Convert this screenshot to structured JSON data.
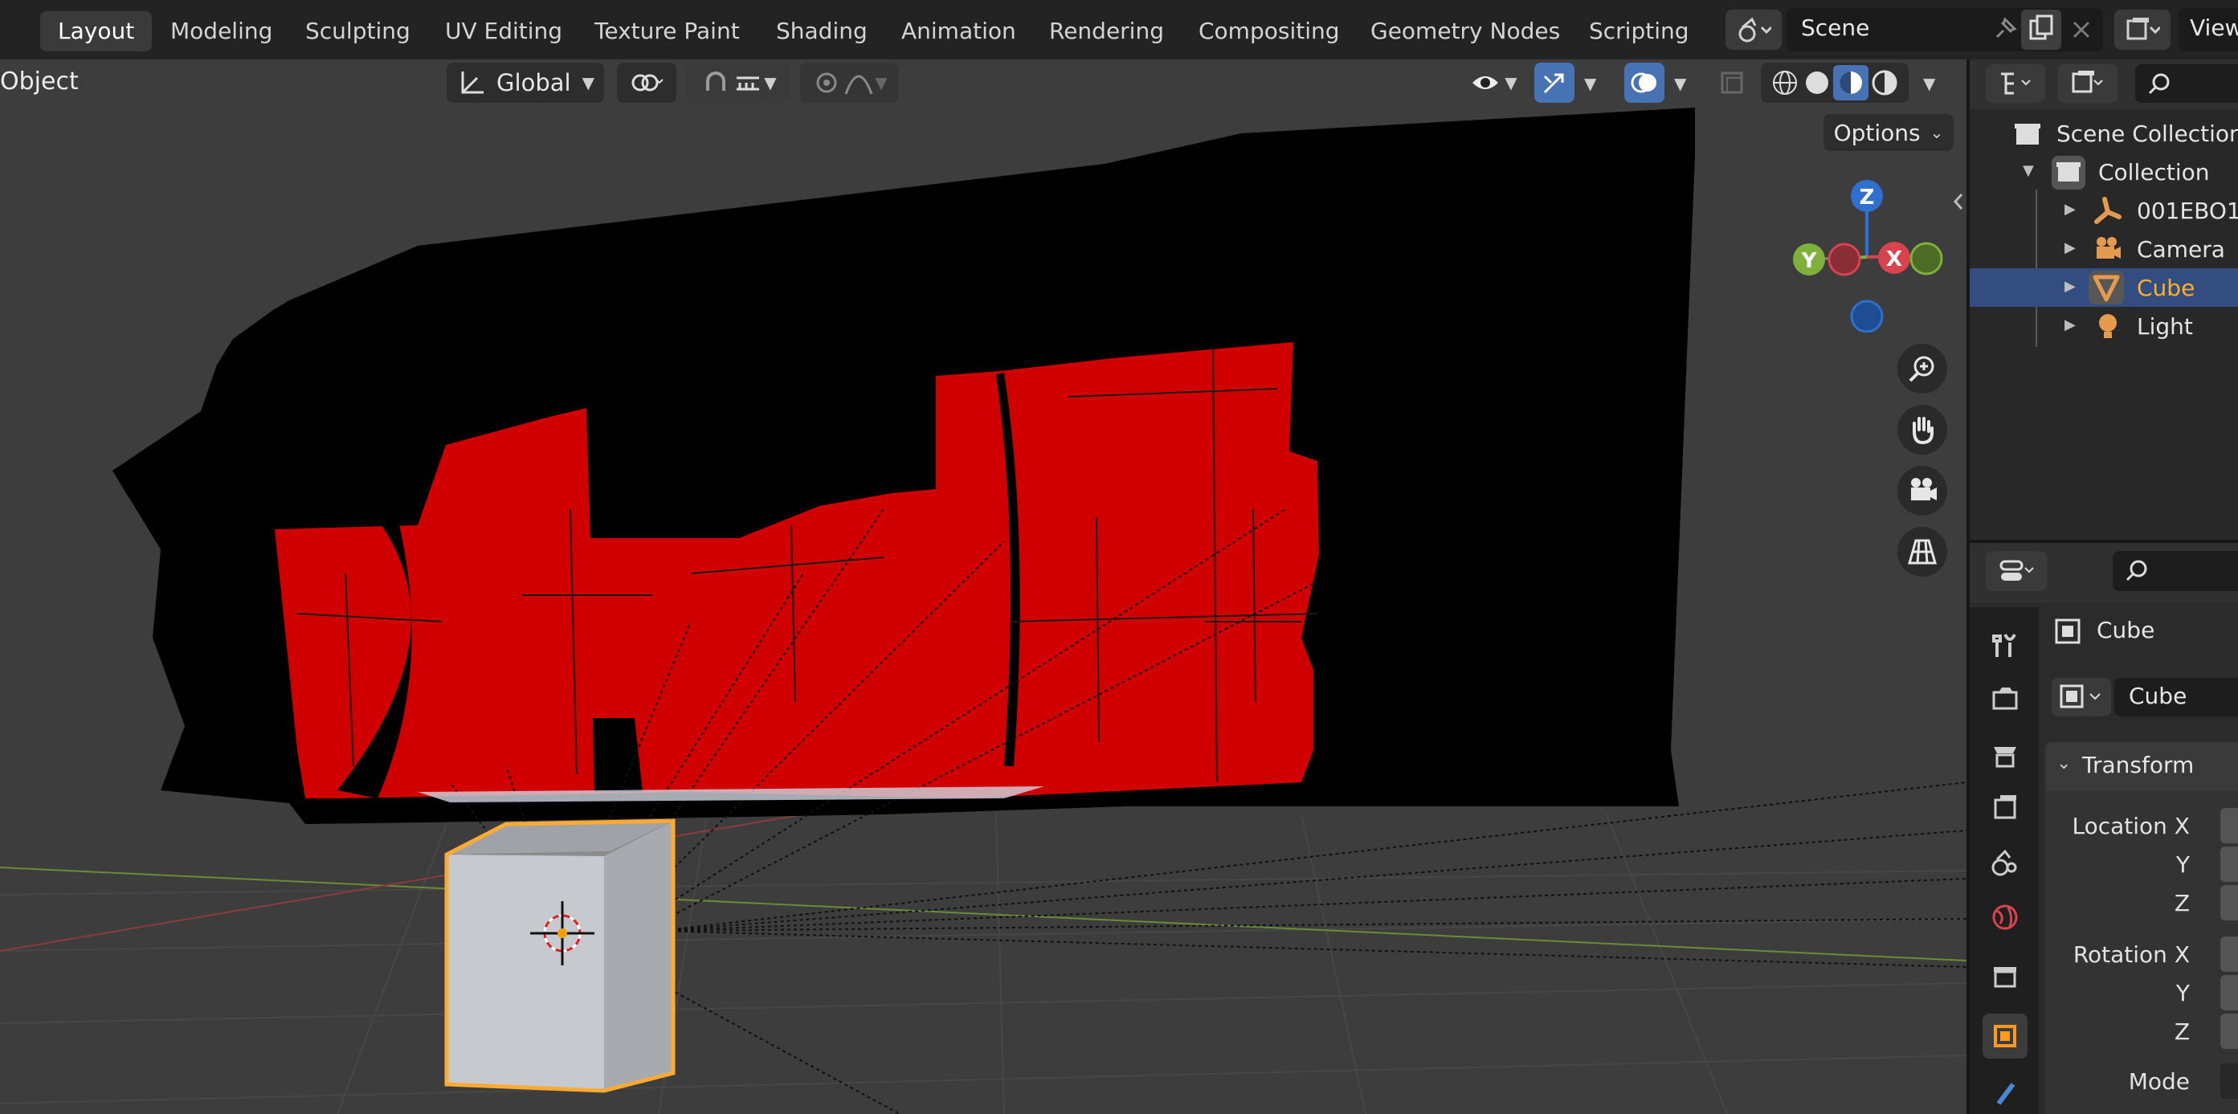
{
  "topbar": {
    "tabs": [
      "Layout",
      "Modeling",
      "Sculpting",
      "UV Editing",
      "Texture Paint",
      "Shading",
      "Animation",
      "Rendering",
      "Compositing",
      "Geometry Nodes",
      "Scripting"
    ],
    "active_tab": "Layout",
    "scene_name": "Scene",
    "view_layer_label": "View"
  },
  "viewport": {
    "mode_label": "Object",
    "orientation": "Global",
    "options_label": "Options",
    "gizmo_axes": {
      "z": "Z",
      "y": "Y",
      "x": "X"
    },
    "colors": {
      "background": "#3d3d3d",
      "red_mesh": "#d10000",
      "black_mesh": "#000000",
      "cube_outline": "#ffaa33"
    }
  },
  "outliner": {
    "root": "Scene Collection",
    "collection": "Collection",
    "items": [
      {
        "label": "001EBO1",
        "icon": "armature-icon",
        "selected": false
      },
      {
        "label": "Camera",
        "icon": "camera-icon",
        "selected": false
      },
      {
        "label": "Cube",
        "icon": "mesh-icon",
        "selected": true
      },
      {
        "label": "Light",
        "icon": "light-icon",
        "selected": false
      }
    ]
  },
  "properties": {
    "object_name": "Cube",
    "datablock_name": "Cube",
    "panel_title": "Transform",
    "fields": {
      "location_x": "Location X",
      "location_y": "Y",
      "location_z": "Z",
      "rotation_x": "Rotation X",
      "rotation_y": "Y",
      "rotation_z": "Z",
      "mode": "Mode"
    }
  }
}
